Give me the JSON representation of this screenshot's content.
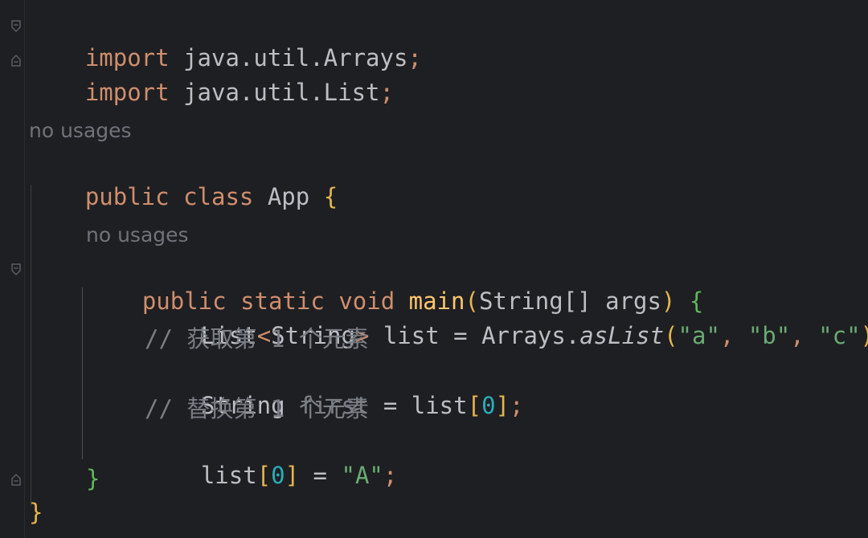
{
  "code": {
    "line1": {
      "kw": "import",
      "rest": " java.util.Arrays",
      "semi": ";"
    },
    "line2": {
      "kw": "import",
      "rest": " java.util.List",
      "semi": ";"
    },
    "hint_class": "no usages",
    "line_class": {
      "kw1": "public",
      "kw2": "class",
      "name": " App ",
      "brace": "{"
    },
    "hint_main": "no usages",
    "line_main": {
      "kw1": "public",
      "kw2": "static",
      "kw3": "void",
      "fn": "main",
      "p_open": "(",
      "params": "String[] args",
      "p_close": ")",
      "brace": "{"
    },
    "line_list": {
      "type": "List",
      "generic_open": "<",
      "generic_type": "String",
      "generic_close": ">",
      "var": " list = Arrays.",
      "call": "asList",
      "p_open": "(",
      "s1": "\"a\"",
      "c1": ", ",
      "s2": "\"b\"",
      "c2": ", ",
      "s3": "\"c\"",
      "p_close": ")",
      "semi": ";"
    },
    "comment1": "// 获取第 1 个元素",
    "line_first": {
      "type": "String",
      "var": " first",
      "eq": " = list",
      "b_open": "[",
      "idx": "0",
      "b_close": "]",
      "semi": ";"
    },
    "comment2": "// 替换第 1 个元素",
    "line_assign": {
      "var": "list",
      "b_open": "[",
      "idx": "0",
      "b_close": "]",
      "eq": " = ",
      "str": "\"A\"",
      "semi": ";"
    },
    "close_method": "}",
    "close_class": "}"
  },
  "colors": {
    "background": "#1e1f22",
    "keyword": "#cf8e6d",
    "string": "#6aab73",
    "number": "#2aacb8",
    "comment": "#7a7e85",
    "method": "#ffc66d",
    "text": "#bcbec4"
  }
}
